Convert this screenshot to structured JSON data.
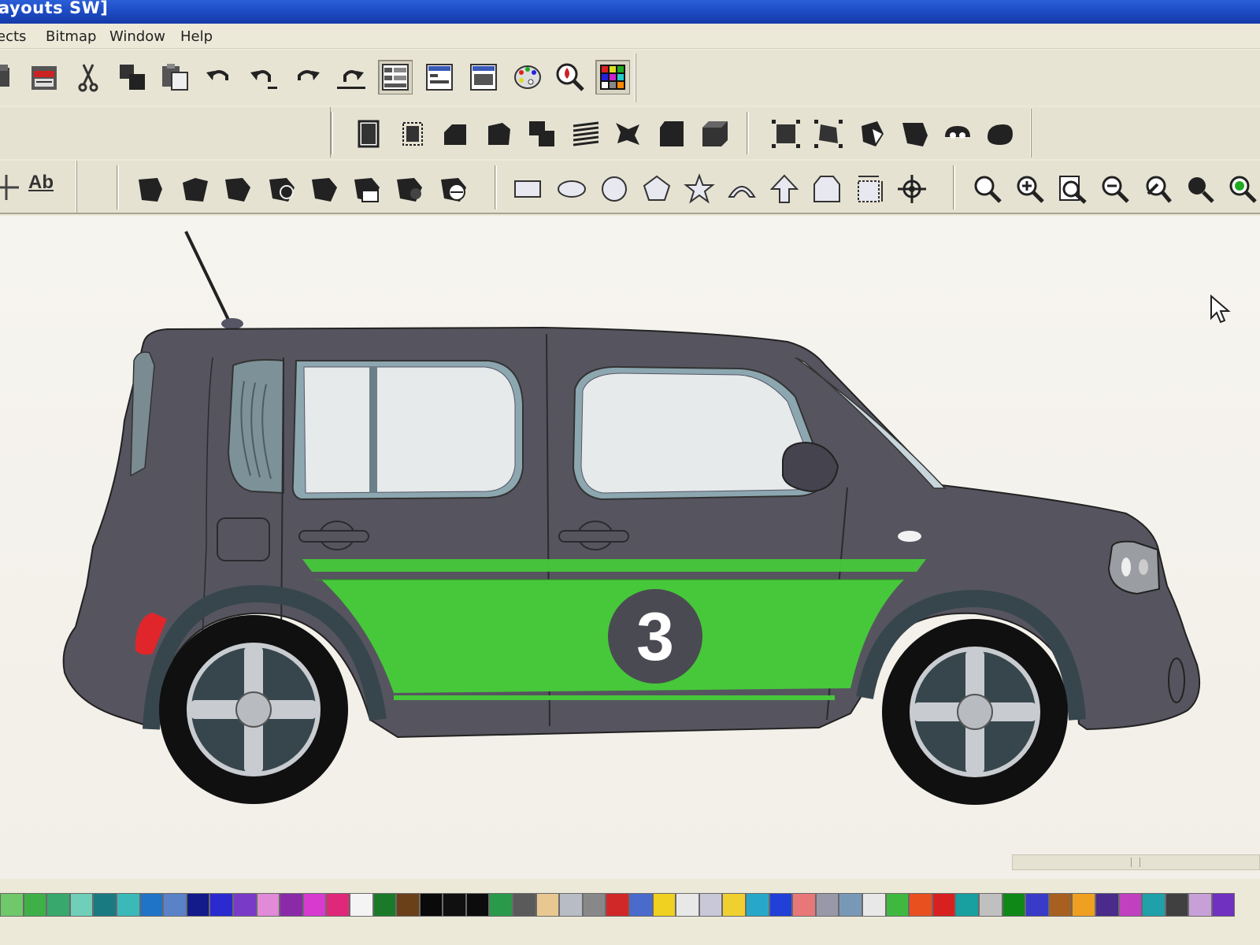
{
  "window": {
    "title": "ayouts SW]"
  },
  "menu": {
    "items": [
      "ects",
      "Bitmap",
      "Window",
      "Help"
    ]
  },
  "toolbar": {
    "text_tool_label": "Ab"
  },
  "canvas": {
    "design": {
      "number_badge": "3",
      "colors": {
        "body": "#56555f",
        "stripe": "#46c83a",
        "glass": "#e6eaea",
        "tire": "#101010",
        "rim": "#c8ccd0",
        "taillight": "#e0262a"
      }
    }
  },
  "palette": {
    "swatch_colors": [
      "#6fc86a",
      "#3fb048",
      "#39a86c",
      "#6fcfb8",
      "#1a7a82",
      "#3ab9b8",
      "#1f74c8",
      "#5a82c8",
      "#131a8a",
      "#2a2ad0",
      "#7a3ac8",
      "#e08ad8",
      "#8a2aa8",
      "#d83ad0",
      "#e0287a",
      "#f4f4f4",
      "#1a7a2a",
      "#6a4018",
      "#0a0a0a",
      "#101010",
      "#0c0c0c",
      "#2a9a4a",
      "#5a5a5a",
      "#e8c890",
      "#b8bcc4",
      "#888888",
      "#d02828",
      "#4a6acc",
      "#f0d020",
      "#e8e8e8",
      "#c8c8d8",
      "#f0d030",
      "#28a8c8",
      "#2040d8",
      "#e87878",
      "#9898a8",
      "#7898b8",
      "#e8e8e8",
      "#40b840",
      "#e85020",
      "#d82020",
      "#18a0a0",
      "#c0c0c0",
      "#108818",
      "#3a3ac8",
      "#a86020",
      "#f0a020",
      "#4a2a8a",
      "#c040c0",
      "#20a0a8",
      "#404040",
      "#c8a0d8",
      "#7030c0"
    ]
  }
}
